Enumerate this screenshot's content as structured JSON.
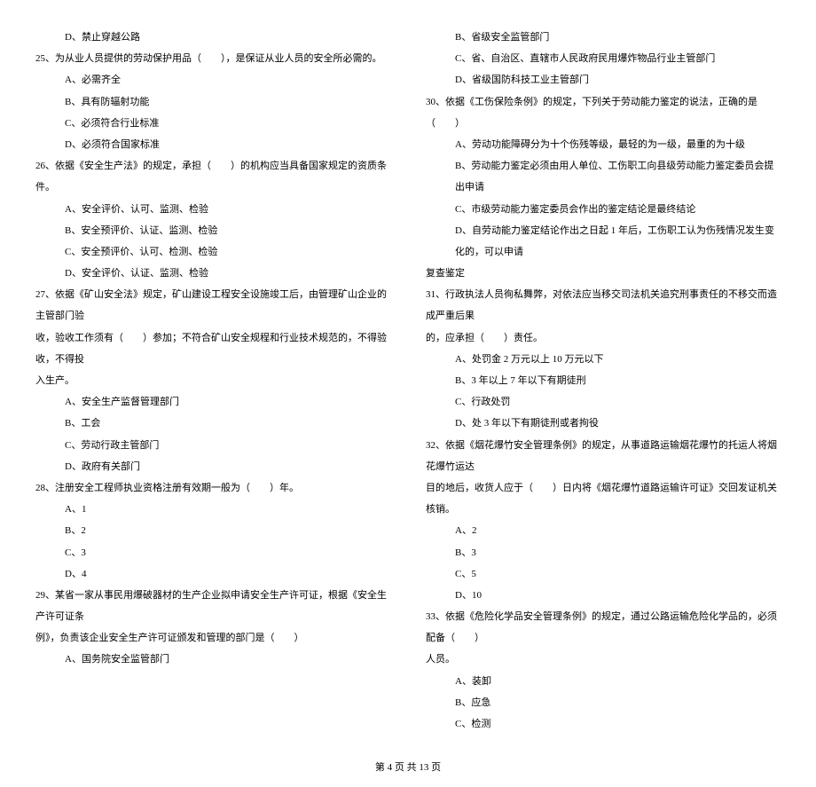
{
  "left": {
    "opt_d_pre": "D、禁止穿越公路",
    "q25": "25、为从业人员提供的劳动保护用品（　　），是保证从业人员的安全所必需的。",
    "q25_a": "A、必需齐全",
    "q25_b": "B、具有防辐射功能",
    "q25_c": "C、必须符合行业标准",
    "q25_d": "D、必须符合国家标准",
    "q26": "26、依据《安全生产法》的规定，承担（　　）的机构应当具备国家规定的资质条件。",
    "q26_a": "A、安全评价、认可、监测、检验",
    "q26_b": "B、安全预评价、认证、监测、检验",
    "q26_c": "C、安全预评价、认可、检测、检验",
    "q26_d": "D、安全评价、认证、监测、检验",
    "q27": "27、依据《矿山安全法》规定，矿山建设工程安全设施竣工后，由管理矿山企业的主管部门验",
    "q27_cont": "收，验收工作须有（　　）参加；不符合矿山安全规程和行业技术规范的，不得验收，不得投",
    "q27_cont2": "入生产。",
    "q27_a": "A、安全生产监督管理部门",
    "q27_b": "B、工会",
    "q27_c": "C、劳动行政主管部门",
    "q27_d": "D、政府有关部门",
    "q28": "28、注册安全工程师执业资格注册有效期一般为（　　）年。",
    "q28_a": "A、1",
    "q28_b": "B、2",
    "q28_c": "C、3",
    "q28_d": "D、4",
    "q29": "29、某省一家从事民用爆破器材的生产企业拟申请安全生产许可证，根据《安全生产许可证条",
    "q29_cont": "例》，负责该企业安全生产许可证颁发和管理的部门是（　　）",
    "q29_a": "A、国务院安全监管部门"
  },
  "right": {
    "q29_b": "B、省级安全监管部门",
    "q29_c": "C、省、自治区、直辖市人民政府民用爆炸物品行业主管部门",
    "q29_d": "D、省级国防科技工业主管部门",
    "q30": "30、依据《工伤保险条例》的规定，下列关于劳动能力鉴定的说法，正确的是（　　）",
    "q30_a": "A、劳动功能障碍分为十个伤残等级，最轻的为一级，最重的为十级",
    "q30_b": "B、劳动能力鉴定必须由用人单位、工伤职工向县级劳动能力鉴定委员会提出申请",
    "q30_c": "C、市级劳动能力鉴定委员会作出的鉴定结论是最终结论",
    "q30_d": "D、自劳动能力鉴定结论作出之日起 1 年后，工伤职工认为伤残情况发生变化的，可以申请",
    "q30_d_cont": "复查鉴定",
    "q31": "31、行政执法人员徇私舞弊，对依法应当移交司法机关追究刑事责任的不移交而造成严重后果",
    "q31_cont": "的，应承担（　　）责任。",
    "q31_a": "A、处罚金 2 万元以上 10 万元以下",
    "q31_b": "B、3 年以上 7 年以下有期徒刑",
    "q31_c": "C、行政处罚",
    "q31_d": "D、处 3 年以下有期徒刑或者拘役",
    "q32": "32、依据《烟花爆竹安全管理条例》的规定，从事道路运输烟花爆竹的托运人将烟花爆竹运达",
    "q32_cont": "目的地后，收货人应于（　　）日内将《烟花爆竹道路运输许可证》交回发证机关核销。",
    "q32_a": "A、2",
    "q32_b": "B、3",
    "q32_c": "C、5",
    "q32_d": "D、10",
    "q33": "33、依据《危险化学品安全管理条例》的规定，通过公路运输危险化学品的，必须配备（　　）",
    "q33_cont": "人员。",
    "q33_a": "A、装卸",
    "q33_b": "B、应急",
    "q33_c": "C、检测"
  },
  "footer": "第 4 页 共 13 页"
}
